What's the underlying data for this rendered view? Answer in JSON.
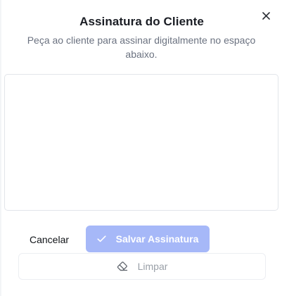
{
  "dialog": {
    "title": "Assinatura do Cliente",
    "subtitle": "Peça ao cliente para assinar digitalmente no espaço abaixo.",
    "close_icon": "close-icon"
  },
  "signature_pad": {
    "icon": "none"
  },
  "actions": {
    "cancel_label": "Cancelar",
    "save_label": "Salvar Assinatura",
    "save_icon": "check-icon",
    "clear_label": "Limpar",
    "clear_icon": "eraser-icon"
  },
  "colors": {
    "primary_disabled": "#a6b8f8",
    "text_primary": "#1a1d24",
    "text_muted": "#6b7280"
  }
}
